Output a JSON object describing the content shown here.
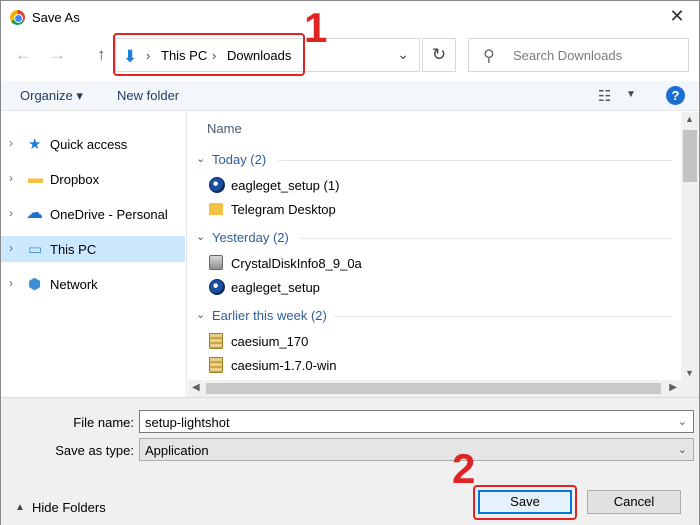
{
  "window": {
    "title": "Save As",
    "close_glyph": "✕",
    "app_icon": "chrome-icon"
  },
  "nav": {
    "back_glyph": "←",
    "forward_glyph": "→",
    "up_glyph": "↑"
  },
  "address": {
    "icon": "download-arrow-icon",
    "crumbs": [
      "This PC",
      "Downloads"
    ],
    "separator": "›",
    "dropdown_glyph": "⌄"
  },
  "refresh_glyph": "↻",
  "search": {
    "placeholder": "Search Downloads",
    "icon_glyph": "⚲"
  },
  "toolbar": {
    "organize": "Organize ▾",
    "new_folder": "New folder",
    "view_glyph": "☷",
    "view_caret": "▼",
    "help": "?"
  },
  "sidebar": {
    "items": [
      {
        "label": "Quick access",
        "icon": "star-icon",
        "glyph": "★",
        "color": "#1e7fd8",
        "selected": false
      },
      {
        "label": "Dropbox",
        "icon": "folder-icon",
        "glyph": "▬",
        "color": "#f4c242",
        "selected": false
      },
      {
        "label": "OneDrive - Personal",
        "icon": "cloud-icon",
        "glyph": "☁",
        "color": "#1f6fd1",
        "selected": false
      },
      {
        "label": "This PC",
        "icon": "computer-icon",
        "glyph": "▭",
        "color": "#3d8fd8",
        "selected": true
      },
      {
        "label": "Network",
        "icon": "network-icon",
        "glyph": "⬢",
        "color": "#3d8fd8",
        "selected": false
      }
    ],
    "chevron": "›"
  },
  "files": {
    "column_header": "Name",
    "groups": [
      {
        "label": "Today (2)",
        "items": [
          {
            "name": "eagleget_setup (1)",
            "icon": "eagleget-icon"
          },
          {
            "name": "Telegram Desktop",
            "icon": "folder-icon"
          }
        ]
      },
      {
        "label": "Yesterday (2)",
        "items": [
          {
            "name": "CrystalDiskInfo8_9_0a",
            "icon": "crystaldisk-icon"
          },
          {
            "name": "eagleget_setup",
            "icon": "eagleget-icon"
          }
        ]
      },
      {
        "label": "Earlier this week (2)",
        "items": [
          {
            "name": "caesium_170",
            "icon": "zip-icon"
          },
          {
            "name": "caesium-1.7.0-win",
            "icon": "zip-icon"
          }
        ]
      }
    ],
    "group_chevron": "⌄"
  },
  "form": {
    "file_name_label": "File name:",
    "file_name_value": "setup-lightshot",
    "save_type_label": "Save as type:",
    "save_type_value": "Application",
    "caret": "⌄"
  },
  "footer": {
    "hide_folders": "Hide Folders",
    "hide_caret": "▲",
    "save": "Save",
    "cancel": "Cancel"
  },
  "annotations": {
    "step1": "1",
    "step2": "2",
    "color": "#e02424"
  }
}
